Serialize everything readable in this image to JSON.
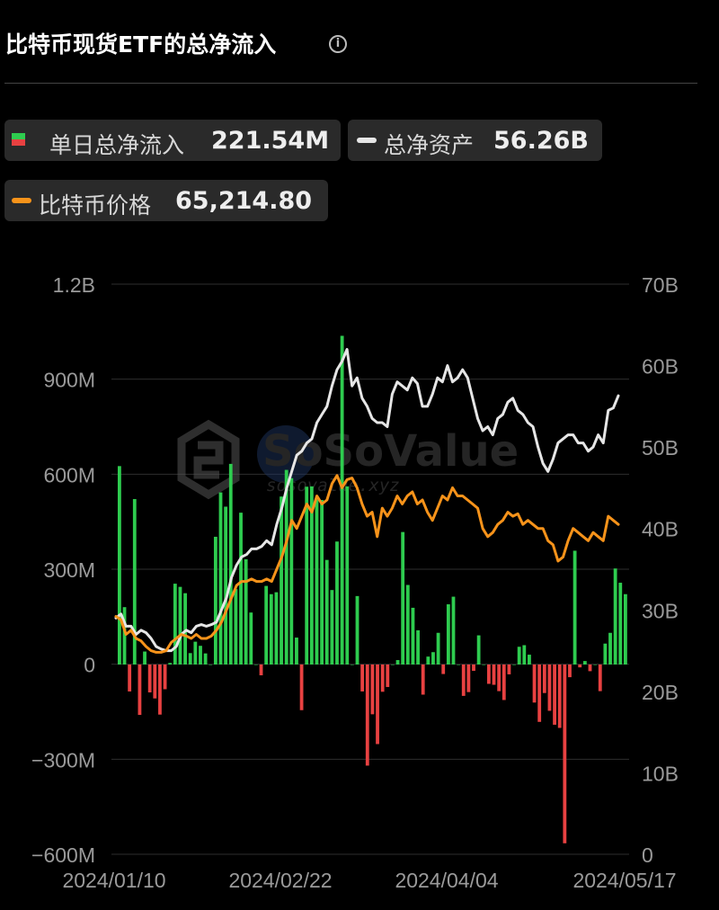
{
  "header": {
    "title": "比特币现货ETF的总净流入",
    "info_icon": "info-circle-icon"
  },
  "legend": {
    "flow": {
      "label": "单日总净流入",
      "value": "221.54M",
      "colors": [
        "#2ecc4f",
        "#e84141"
      ]
    },
    "assets": {
      "label": "总净资产",
      "value": "56.26B",
      "color": "#e6e6e6"
    },
    "price": {
      "label": "比特币价格",
      "value": "65,214.80",
      "color": "#f7931a"
    }
  },
  "watermark": {
    "brand": "SoSoValue",
    "url": "sosovalue.xyz"
  },
  "chart_data": {
    "type": "bar+line",
    "x_ticks": [
      "2024/01/10",
      "2024/02/22",
      "2024/04/04",
      "2024/05/17"
    ],
    "left_axis": {
      "ticks": [
        "1.2B",
        "900M",
        "600M",
        "300M",
        "0",
        "−300M",
        "−600M"
      ],
      "range": [
        -600,
        1200
      ],
      "unit": "M USD"
    },
    "right_axis": {
      "ticks": [
        "70B",
        "60B",
        "50B",
        "40B",
        "30B",
        "20B",
        "10B",
        "0"
      ],
      "range": [
        0,
        70
      ],
      "unit": "B USD"
    },
    "series": [
      {
        "name": "单日总净流入",
        "axis": "left",
        "values": [
          626,
          181,
          -85,
          522,
          -159,
          41,
          -88,
          -107,
          -158,
          -78,
          5,
          255,
          245,
          225,
          36,
          72,
          59,
          35,
          0,
          403,
          543,
          498,
          633,
          238,
          479,
          332,
          164,
          0,
          -34,
          248,
          222,
          228,
          530,
          614,
          588,
          85,
          -144,
          561,
          562,
          520,
          519,
          330,
          235,
          388,
          1037,
          562,
          0,
          216,
          -85,
          -319,
          -157,
          -251,
          -86,
          -71,
          0,
          14,
          418,
          251,
          179,
          108,
          -95,
          25,
          39,
          100,
          -30,
          190,
          214,
          0,
          -99,
          -87,
          -20,
          92,
          0,
          -61,
          -64,
          -84,
          -112,
          -31,
          0,
          56,
          61,
          31,
          -120,
          -181,
          -90,
          -146,
          -190,
          -200,
          -564,
          -40,
          359,
          -9,
          11,
          -21,
          0,
          -84,
          66,
          100,
          303,
          258,
          222
        ]
      },
      {
        "name": "总净资产",
        "axis": "right",
        "values": [
          29.0,
          29.5,
          28.0,
          28.0,
          27.0,
          27.5,
          27.2,
          26.5,
          25.5,
          25.2,
          25.0,
          25.0,
          25.5,
          27.0,
          27.5,
          27.2,
          28.0,
          28.2,
          28.0,
          28.2,
          28.5,
          30.0,
          31.5,
          34.0,
          35.5,
          36.5,
          36.8,
          37.5,
          37.5,
          37.8,
          38.5,
          38.0,
          40.5,
          42.5,
          45.0,
          47.0,
          49.0,
          49.5,
          50.5,
          51.0,
          53.0,
          54.0,
          55.0,
          57.5,
          59.5,
          60.5,
          62.0,
          57.5,
          58.5,
          56.0,
          55.0,
          53.5,
          53.0,
          53.0,
          52.5,
          56.5,
          58.0,
          57.5,
          57.0,
          58.5,
          57.8,
          55.0,
          55.0,
          56.5,
          58.5,
          58.0,
          60.0,
          58.0,
          58.5,
          59.5,
          58.5,
          56.0,
          53.5,
          52.0,
          52.5,
          51.5,
          53.5,
          54.0,
          55.5,
          56.0,
          54.5,
          54.0,
          53.0,
          52.5,
          50.0,
          48.0,
          47.0,
          48.5,
          50.5,
          51.0,
          51.5,
          51.5,
          50.5,
          50.5,
          49.5,
          50.0,
          51.5,
          50.5,
          54.5,
          54.8,
          56.3
        ]
      },
      {
        "name": "比特币价格",
        "axis": "right",
        "values": [
          29.2,
          28.8,
          27.0,
          27.5,
          26.5,
          26.2,
          25.5,
          25.0,
          24.8,
          24.8,
          25.0,
          26.0,
          26.5,
          27.0,
          26.8,
          26.5,
          27.0,
          26.5,
          26.5,
          26.8,
          27.5,
          28.5,
          30.0,
          31.5,
          33.0,
          33.5,
          33.5,
          33.8,
          33.5,
          33.5,
          33.8,
          33.5,
          35.0,
          36.5,
          38.5,
          41.0,
          40.0,
          41.5,
          43.0,
          42.0,
          44.0,
          43.0,
          43.5,
          45.5,
          46.5,
          45.0,
          46.0,
          46.2,
          45.0,
          43.0,
          41.5,
          42.0,
          39.0,
          42.5,
          41.5,
          42.5,
          44.0,
          43.0,
          44.0,
          44.5,
          43.0,
          43.5,
          42.0,
          41.0,
          42.5,
          44.0,
          43.5,
          45.0,
          44.0,
          44.0,
          43.5,
          43.0,
          42.5,
          40.0,
          39.0,
          39.5,
          40.5,
          41.0,
          42.0,
          41.5,
          41.8,
          40.5,
          41.0,
          40.5,
          40.0,
          40.0,
          38.5,
          38.0,
          36.0,
          36.5,
          38.5,
          40.0,
          39.5,
          39.0,
          38.5,
          39.5,
          39.0,
          38.5,
          41.5,
          41.0,
          40.5
        ]
      }
    ]
  }
}
